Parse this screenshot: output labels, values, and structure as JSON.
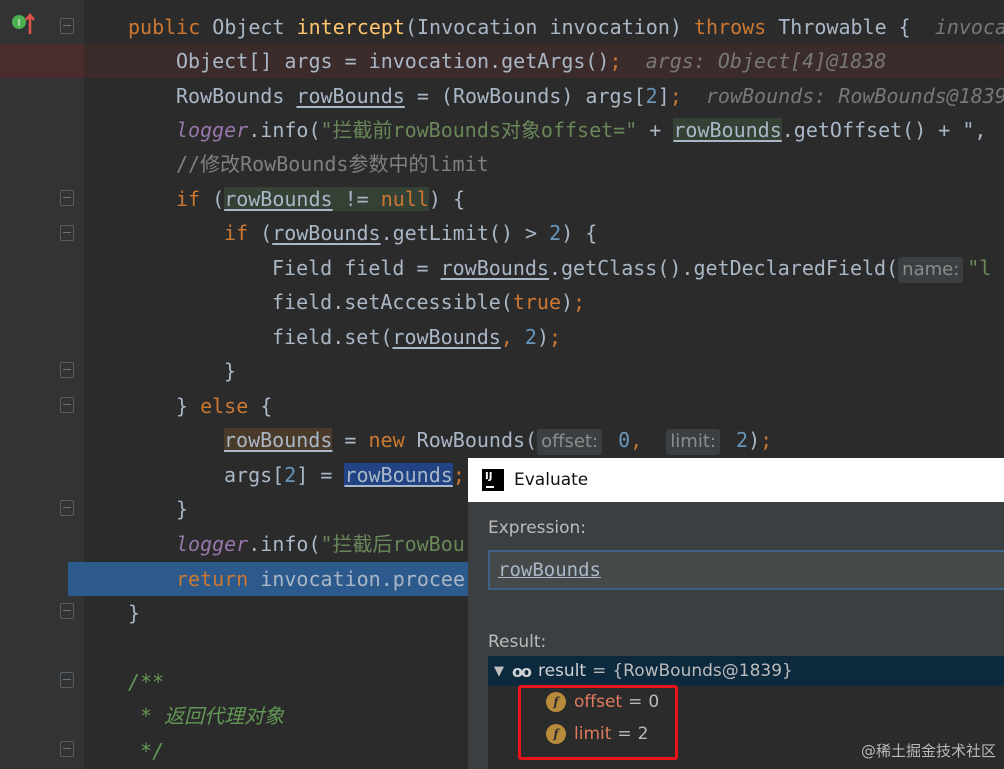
{
  "editor": {
    "line1": {
      "kw_public": "public",
      "type_object": "Object",
      "method_name": "intercept",
      "params": "(Invocation invocation)",
      "kw_throws": "throws",
      "throwable": "Throwable {",
      "hint": "invoca"
    },
    "line2": {
      "code": "Object[] args = invocation.getArgs()",
      "semi": ";",
      "hint": "args: Object[4]@1838"
    },
    "line3": {
      "type": "RowBounds ",
      "var": "rowBounds",
      "rest": " = (RowBounds) args[",
      "idx": "2",
      "close": "]",
      "semi": ";",
      "hint": "rowBounds: RowBounds@1839"
    },
    "line4": {
      "logger": "logger",
      "call": ".info(",
      "str": "\"拦截前rowBounds对象offset=\"",
      "plus": " + ",
      "var": "rowBounds",
      "rest": ".getOffset() + \",",
      "str_end": ""
    },
    "line5": {
      "comment": "//修改RowBounds参数中的limit"
    },
    "line6": {
      "kw_if": "if",
      "open": " (",
      "var": "rowBounds",
      "op": " != ",
      "kw_null": "null",
      "close": ") {"
    },
    "line7": {
      "kw_if": "if",
      "open": " (",
      "var": "rowBounds",
      "rest": ".getLimit() > ",
      "num": "2",
      "close": ") {"
    },
    "line8": {
      "code": "Field field = ",
      "var": "rowBounds",
      "rest": ".getClass().getDeclaredField(",
      "param_hint": "name:",
      "str": "\"l"
    },
    "line9": {
      "code": "field.setAccessible(",
      "kw_true": "true",
      "close": ")",
      "semi": ";"
    },
    "line10": {
      "code": "field.set(",
      "var": "rowBounds",
      "comma": ", ",
      "num": "2",
      "close": ")",
      "semi": ";"
    },
    "line11": {
      "code": "}"
    },
    "line12": {
      "brace": "} ",
      "kw_else": "else",
      "open": " {"
    },
    "line13": {
      "var": "rowBounds",
      "eq": " = ",
      "kw_new": "new",
      "type": " RowBounds(",
      "hint1": "offset:",
      "num1": " 0",
      "comma": ",  ",
      "hint2": "limit:",
      "num2": " 2",
      "close": ")",
      "semi": ";"
    },
    "line14": {
      "code": "args[",
      "idx": "2",
      "rest": "] = ",
      "var": "rowBounds",
      "semi": ";"
    },
    "line15": {
      "code": "}"
    },
    "line16": {
      "logger": "logger",
      "call": ".info(",
      "str": "\"拦截后rowBou"
    },
    "line17": {
      "kw_return": "return",
      "code": " invocation.procee"
    },
    "line18": {
      "code": "}"
    },
    "line19": {
      "doc": "/**"
    },
    "line20": {
      "doc": " * 返回代理对象"
    },
    "line21": {
      "doc": " */"
    }
  },
  "dialog": {
    "title": "Evaluate",
    "expression_label": "Expression:",
    "expression_value": "rowBounds",
    "result_label": "Result:",
    "result": {
      "name": "result",
      "eq": "=",
      "value": "{RowBounds@1839}",
      "fields": [
        {
          "icon": "f",
          "name": "offset",
          "eq": "=",
          "value": "0"
        },
        {
          "icon": "f",
          "name": "limit",
          "eq": "=",
          "value": "2"
        }
      ]
    }
  },
  "watermark": "@稀土掘金技术社区",
  "colors": {
    "editor_bg": "#2b2b2b",
    "keyword": "#cc7832",
    "string": "#6a8759",
    "number": "#6897bb",
    "current_line": "#2d5a8c",
    "highlight_box": "#e8141a"
  }
}
